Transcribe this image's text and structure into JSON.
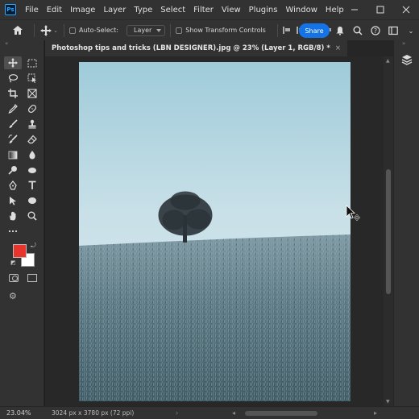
{
  "app": {
    "logo_text": "Ps"
  },
  "menu": [
    "File",
    "Edit",
    "Image",
    "Layer",
    "Type",
    "Select",
    "Filter",
    "View",
    "Plugins",
    "Window",
    "Help"
  ],
  "options": {
    "auto_select_label": "Auto-Select:",
    "layer_dropdown": "Layer",
    "show_transform_label": "Show Transform Controls",
    "share_label": "Share"
  },
  "document": {
    "tab_title": "Photoshop tips and tricks (LBN DESIGNER).jpg @ 23% (Layer 1, RGB/8) *",
    "close_glyph": "×"
  },
  "status": {
    "zoom": "23.04%",
    "doc_info": "3024 px x 3780 px (72 ppi)"
  },
  "colors": {
    "foreground": "#e8342c",
    "background": "#ffffff",
    "accent": "#1473e6"
  },
  "tools": [
    "move-tool-icon",
    "artboard-tool-icon",
    "lasso-tool-icon",
    "object-select-tool-icon",
    "crop-tool-icon",
    "frame-tool-icon",
    "eyedropper-tool-icon",
    "spot-healing-tool-icon",
    "brush-tool-icon",
    "clone-stamp-tool-icon",
    "history-brush-tool-icon",
    "eraser-tool-icon",
    "gradient-tool-icon",
    "blur-tool-icon",
    "dodge-tool-icon",
    "smudge-tool-icon",
    "pen-tool-icon",
    "type-tool-icon",
    "path-select-tool-icon",
    "ellipse-tool-icon",
    "hand-tool-icon",
    "zoom-tool-icon",
    "more-tools-icon"
  ]
}
